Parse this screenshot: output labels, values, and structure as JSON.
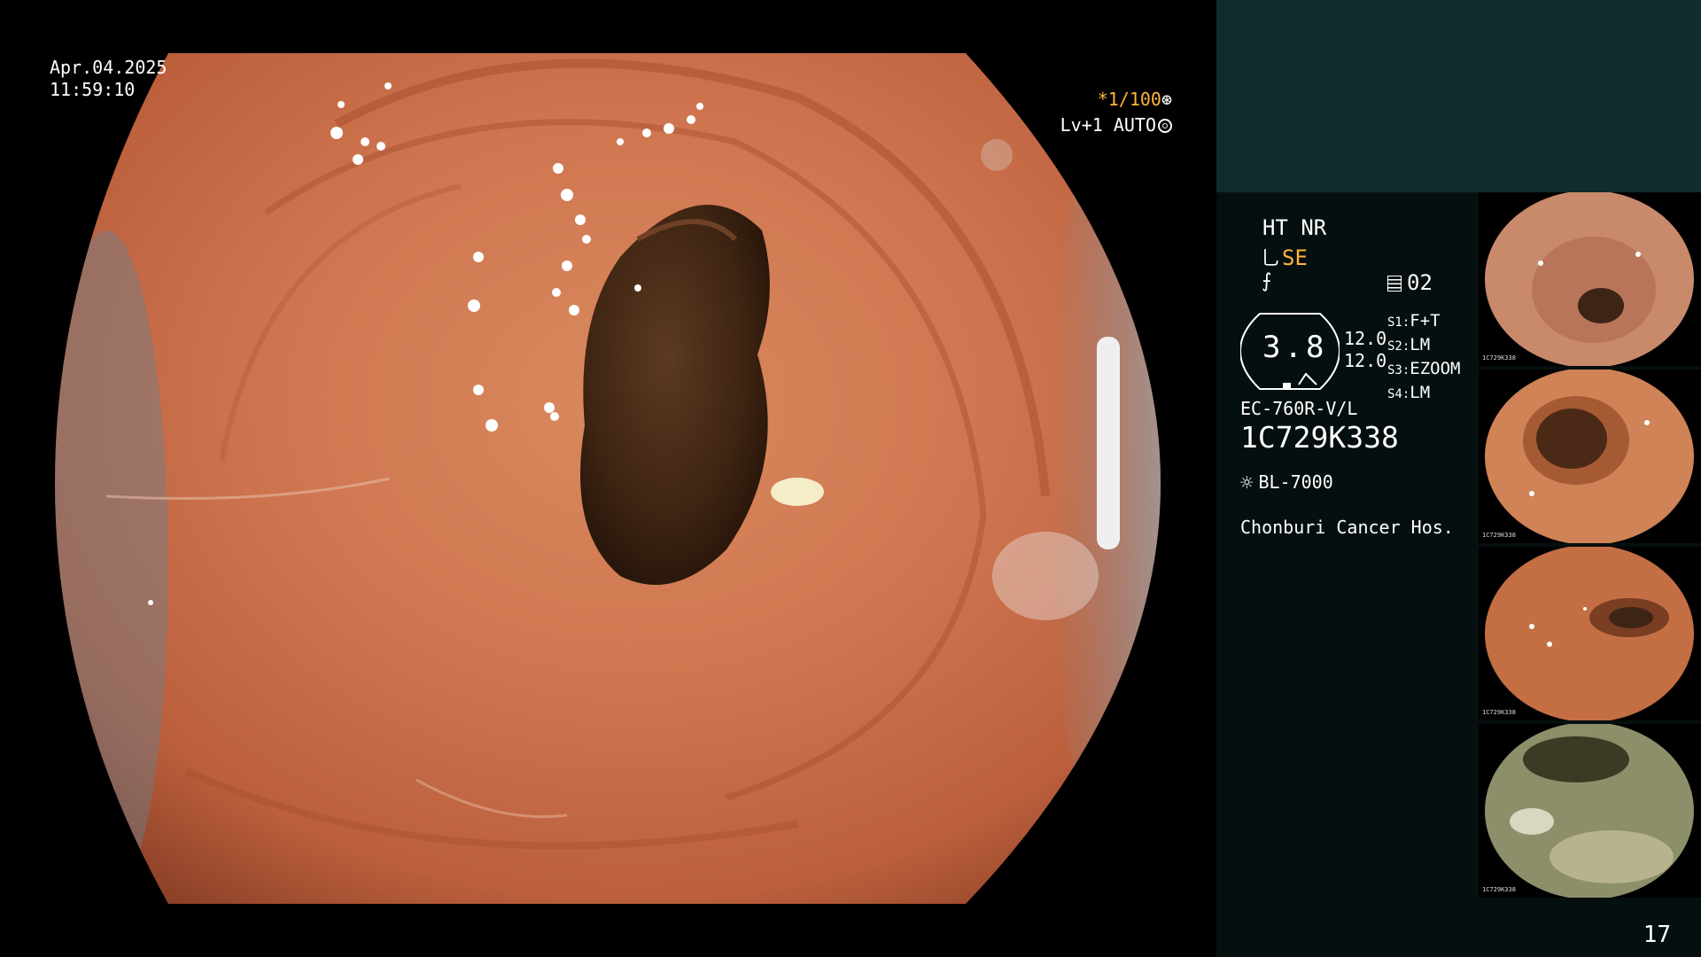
{
  "datetime": {
    "date": "Apr.04.2025",
    "time": "11:59:10"
  },
  "osd": {
    "shutter": "*1/100",
    "level": "Lv+1 AUTO",
    "shutter_icon": "aperture-icon",
    "auto_icon": "iris-icon"
  },
  "panel": {
    "modes": "HT NR",
    "structure_enhancement": "SE",
    "enhancement_icon": "wrench-icon",
    "memory": "02",
    "zoom_value": "3.8",
    "gain_1": "12.0",
    "gain_2": "12.0",
    "s1_key": "S1:",
    "s1_value": "F+T",
    "s2_key": "S2:",
    "s2_value": "LM",
    "s3_key": "S3:",
    "s3_value": "EZOOM",
    "s4_key": "S4:",
    "s4_value": "LM",
    "scope_model": "EC-760R-V/L",
    "serial": "1C729K338",
    "light_source": "BL-7000",
    "hospital": "Chonburi Cancer Hos."
  },
  "thumbnails": [
    {
      "label": "1C729K338"
    },
    {
      "label": "1C729K338"
    },
    {
      "label": "1C729K338"
    },
    {
      "label": "1C729K338"
    }
  ],
  "page_number": "17",
  "colors": {
    "accent": "#ffb43a",
    "panel_top": "#0f2d2d",
    "panel_bg": "#050f0f",
    "mucosa": "#c96b48",
    "lumen": "#4a2a16"
  }
}
